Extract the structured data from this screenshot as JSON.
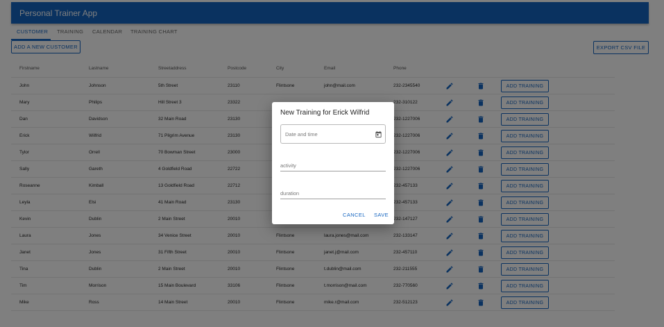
{
  "app": {
    "title": "Personal Trainer App"
  },
  "tabs": [
    {
      "label": "CUSTOMER",
      "active": true
    },
    {
      "label": "TRAINING",
      "active": false
    },
    {
      "label": "CALENDAR",
      "active": false
    },
    {
      "label": "TRAINING CHART",
      "active": false
    }
  ],
  "toolbar": {
    "add_customer_label": "ADD A NEW CUSTOMER",
    "export_csv_label": "EXPORT CSV FILE"
  },
  "table": {
    "columns": [
      "Firstname",
      "Lastname",
      "Streetaddress",
      "Postcode",
      "City",
      "Email",
      "Phone"
    ],
    "rows": [
      [
        "John",
        "Johnson",
        "5th Street",
        "23110",
        "Flintsone",
        "john@mail.com",
        "232-2345540"
      ],
      [
        "Mary",
        "Philips",
        "Hill Street 3",
        "23322",
        "",
        "",
        "232-310122"
      ],
      [
        "Dan",
        "Davidson",
        "32 Main Road",
        "23130",
        "",
        "",
        "232-1227006"
      ],
      [
        "Erick",
        "Wilfrid",
        "71 Pilgrim Avenue",
        "23130",
        "",
        "",
        "232-1227006"
      ],
      [
        "Tylor",
        "Orrell",
        "70 Bowman Street",
        "23000",
        "",
        "",
        "232-1227006"
      ],
      [
        "Sally",
        "Gareth",
        "4 Goldfield Road",
        "22722",
        "",
        "",
        "232-1227006"
      ],
      [
        "Roseanne",
        "Kimball",
        "13 Goldfield Road",
        "22712",
        "",
        "",
        "232-457133"
      ],
      [
        "Leyla",
        "Elsi",
        "41 Main Road",
        "23130",
        "",
        "",
        "232-457133"
      ],
      [
        "Kevin",
        "Dublin",
        "2 Main Street",
        "20010",
        "",
        "",
        "232-147127"
      ],
      [
        "Laura",
        "Jones",
        "34 Venice Street",
        "20010",
        "Flintsone",
        "laura.jones@mail.com",
        "232-133147"
      ],
      [
        "Janet",
        "Jones",
        "31 Fifth Street",
        "20010",
        "Flintsone",
        "janet.j@mail.com",
        "232-457110"
      ],
      [
        "Tina",
        "Dublin",
        "2 Main Street",
        "20010",
        "Flintsone",
        "t.dublin@mail.com",
        "232-211555"
      ],
      [
        "Tim",
        "Morrison",
        "15 Main Boulevard",
        "33106",
        "Flintsone",
        "t.morrison@mail.com",
        "232-770560"
      ],
      [
        "Mike",
        "Ross",
        "14 Main Street",
        "20010",
        "Flintsone",
        "mike.r@mail.com",
        "232-512123"
      ]
    ],
    "row_action_label": "ADD TRAINING"
  },
  "dialog": {
    "title": "New Training for Erick Wilfrid",
    "date_placeholder": "Date and time",
    "activity_label": "activity",
    "duration_label": "duration",
    "cancel_label": "CANCEL",
    "save_label": "SAVE"
  },
  "icons": {
    "edit": "edit-icon",
    "delete": "delete-icon",
    "calendar": "calendar-icon"
  },
  "colors": {
    "primary": "#1565c0",
    "overlay": "rgba(0,0,0,0.5)"
  }
}
